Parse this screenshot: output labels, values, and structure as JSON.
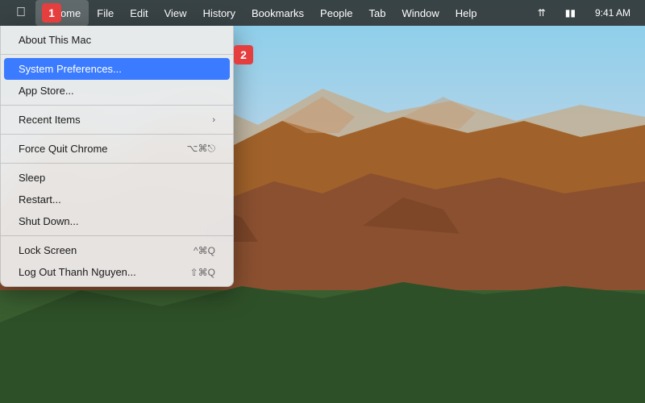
{
  "menubar": {
    "apple_symbol": "&#63743;",
    "items": [
      {
        "label": "Chrome",
        "active": true
      },
      {
        "label": "File"
      },
      {
        "label": "Edit"
      },
      {
        "label": "View"
      },
      {
        "label": "History"
      },
      {
        "label": "Bookmarks"
      },
      {
        "label": "People"
      },
      {
        "label": "Tab"
      },
      {
        "label": "Window"
      },
      {
        "label": "Help"
      }
    ]
  },
  "dropdown": {
    "items": [
      {
        "label": "About This Mac",
        "type": "item",
        "shortcut": ""
      },
      {
        "type": "separator"
      },
      {
        "label": "System Preferences...",
        "type": "item",
        "highlighted": true,
        "shortcut": ""
      },
      {
        "label": "App Store...",
        "type": "item",
        "shortcut": ""
      },
      {
        "type": "separator"
      },
      {
        "label": "Recent Items",
        "type": "submenu",
        "shortcut": ""
      },
      {
        "type": "separator"
      },
      {
        "label": "Force Quit Chrome",
        "type": "item",
        "shortcut": "⌥⌘⎋"
      },
      {
        "type": "separator"
      },
      {
        "label": "Sleep",
        "type": "item",
        "shortcut": ""
      },
      {
        "label": "Restart...",
        "type": "item",
        "shortcut": ""
      },
      {
        "label": "Shut Down...",
        "type": "item",
        "shortcut": ""
      },
      {
        "type": "separator"
      },
      {
        "label": "Lock Screen",
        "type": "item",
        "shortcut": "^⌘Q"
      },
      {
        "label": "Log Out Thanh Nguyen...",
        "type": "item",
        "shortcut": "⇧⌘Q"
      }
    ]
  },
  "steps": {
    "badge1": "1",
    "badge2": "2"
  }
}
